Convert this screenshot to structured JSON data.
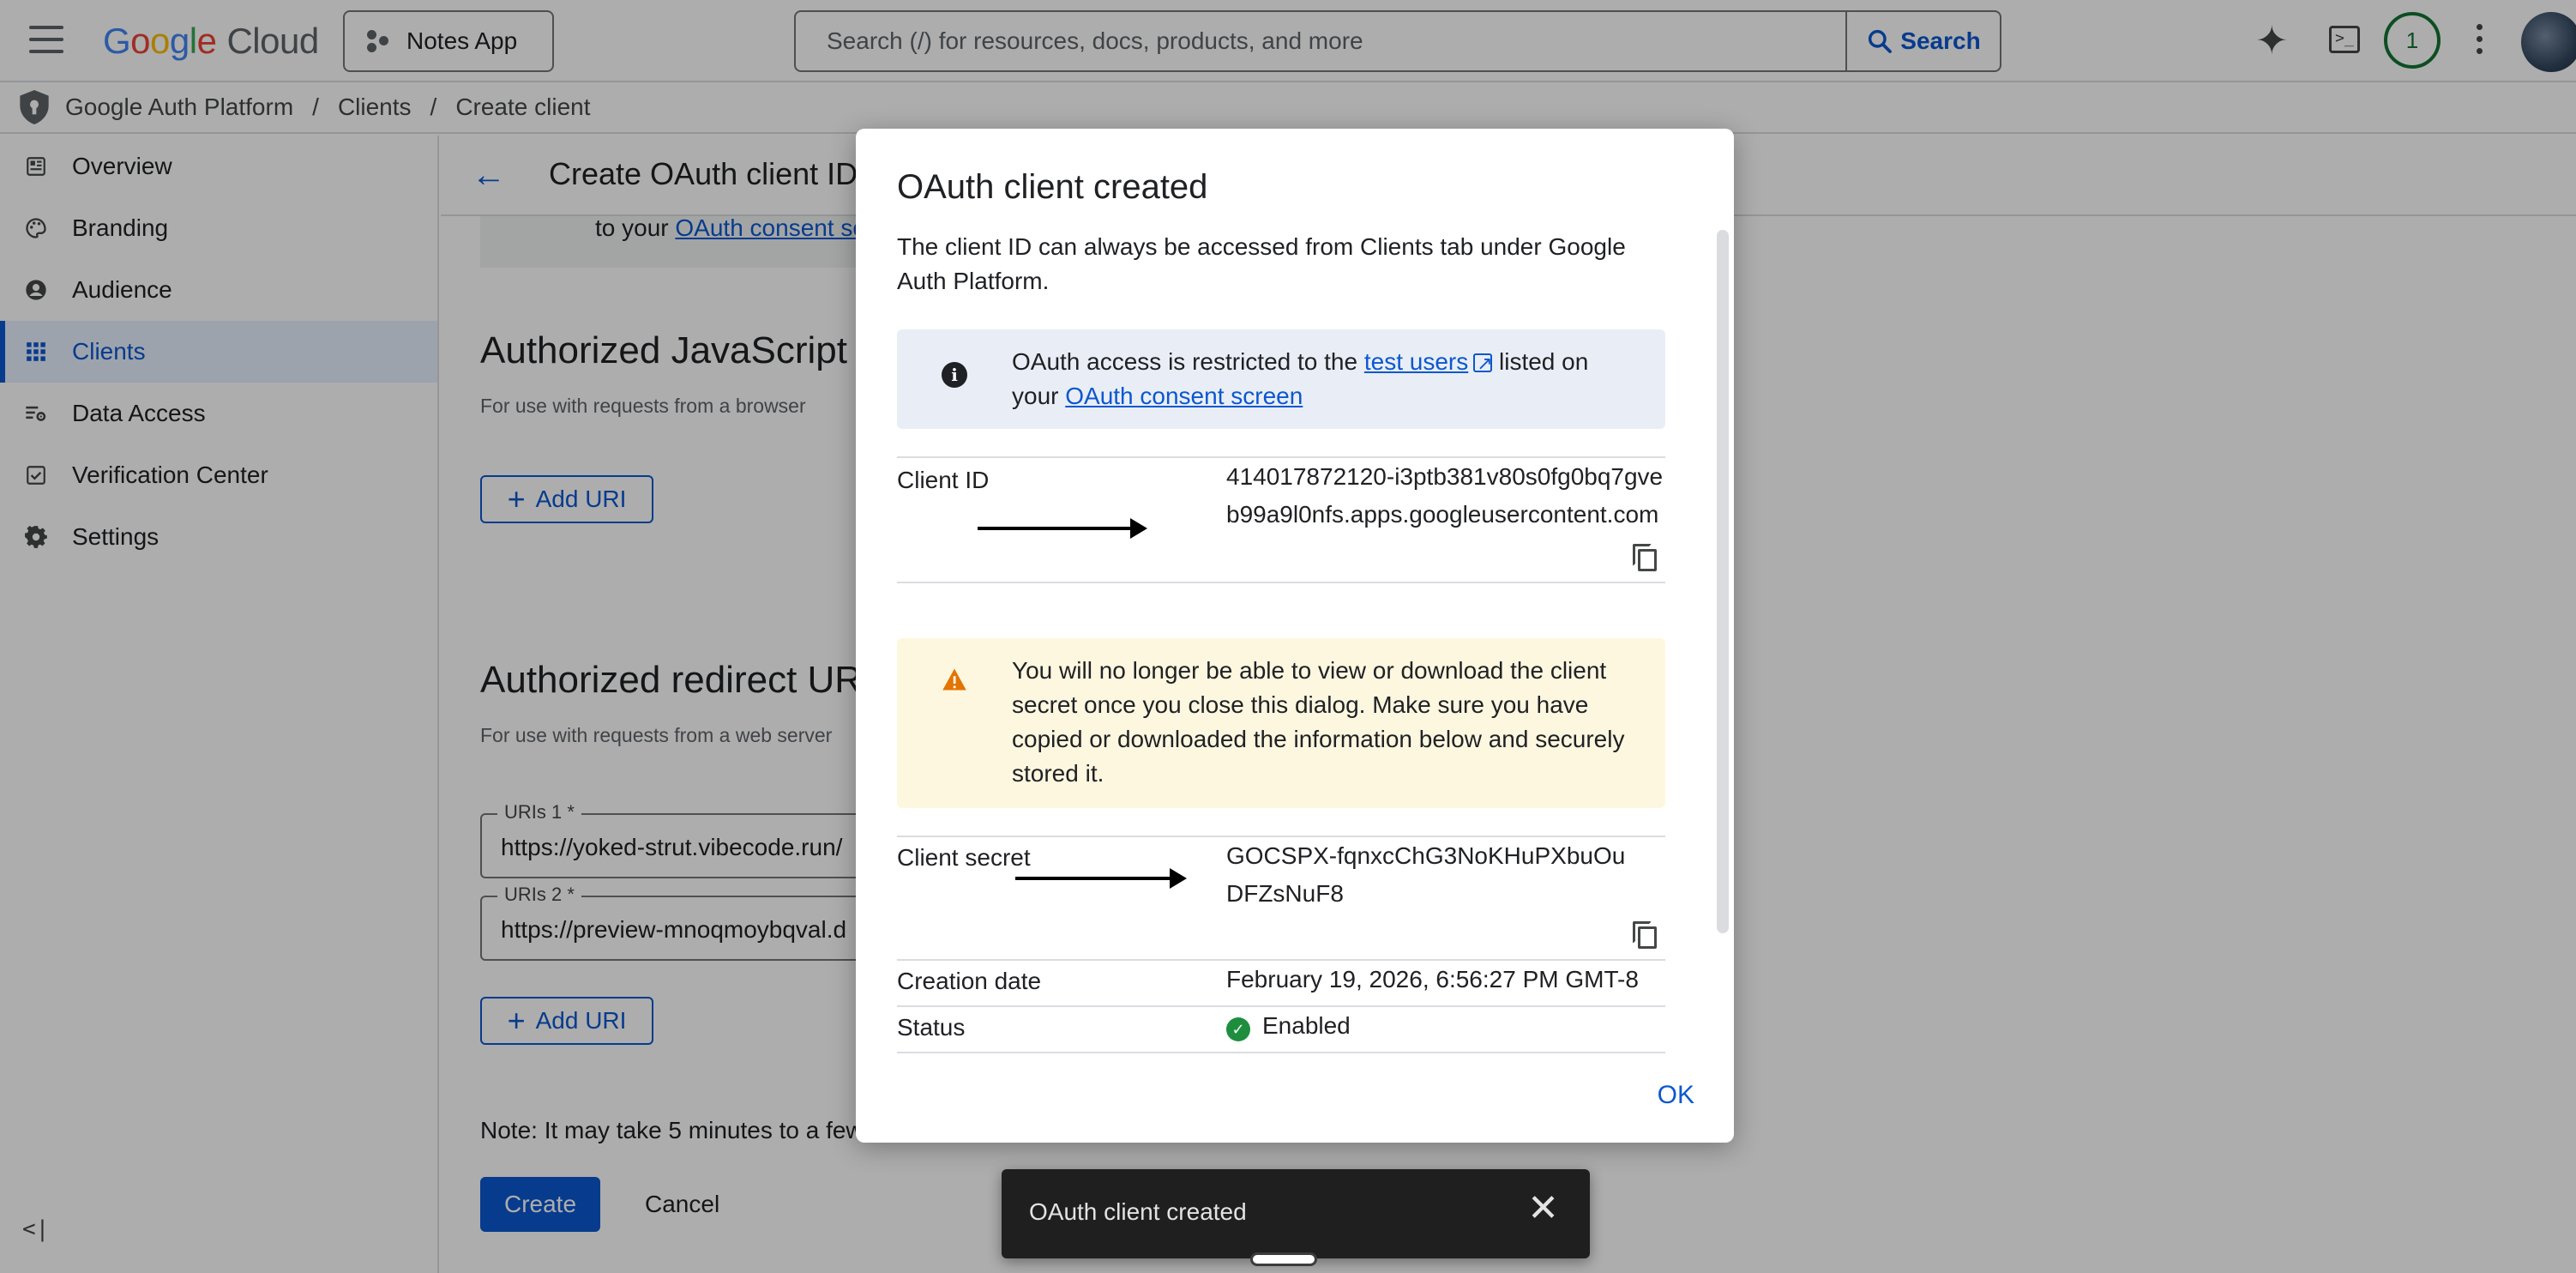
{
  "topbar": {
    "logo_google": [
      "G",
      "o",
      "o",
      "g",
      "l",
      "e"
    ],
    "logo_cloud": "Cloud",
    "project_label": "Notes App",
    "search_placeholder": "Search (/) for resources, docs, products, and more",
    "search_button": "Search",
    "notification_count": "1"
  },
  "breadcrumb": {
    "items": [
      "Google Auth Platform",
      "Clients",
      "Create client"
    ],
    "separator": "/"
  },
  "sidebar": {
    "items": [
      {
        "label": "Overview",
        "icon": "dashboard-icon"
      },
      {
        "label": "Branding",
        "icon": "palette-icon"
      },
      {
        "label": "Audience",
        "icon": "person-circle-icon"
      },
      {
        "label": "Clients",
        "icon": "apps-grid-icon",
        "active": true
      },
      {
        "label": "Data Access",
        "icon": "data-settings-icon"
      },
      {
        "label": "Verification Center",
        "icon": "check-box-icon"
      },
      {
        "label": "Settings",
        "icon": "gear-icon"
      }
    ],
    "collapse_glyph": "<|"
  },
  "main": {
    "page_title": "Create OAuth client ID",
    "consent_text_prefix": "to your",
    "consent_link": "OAuth consent sc",
    "js_origins_title": "Authorized JavaScript",
    "js_origins_sub": "For use with requests from a browser",
    "add_uri_label": "Add URI",
    "redirect_title": "Authorized redirect UR",
    "redirect_sub": "For use with requests from a web server",
    "uris": [
      {
        "label": "URIs 1 *",
        "value": "https://yoked-strut.vibecode.run/"
      },
      {
        "label": "URIs 2 *",
        "value": "https://preview-mnoqmoybqval.d"
      }
    ],
    "note": "Note: It may take 5 minutes to a few",
    "create_label": "Create",
    "cancel_label": "Cancel"
  },
  "dialog": {
    "title": "OAuth client created",
    "description": "The client ID can always be accessed from Clients tab under Google Auth Platform.",
    "info_prefix": "OAuth access is restricted to the",
    "info_link1": "test users",
    "info_middle": "listed on your",
    "info_link2": "OAuth consent screen",
    "client_id_label": "Client ID",
    "client_id_value": "414017872120-i3ptb381v80s0fg0bq7gveb99a9l0nfs.apps.googleusercontent.com",
    "warning": "You will no longer be able to view or download the client secret once you close this dialog. Make sure you have copied or downloaded the information below and securely stored it.",
    "client_secret_label": "Client secret",
    "client_secret_value": "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",
    "creation_date_label": "Creation date",
    "creation_date_value": "February 19, 2026, 6:56:27 PM GMT-8",
    "status_label": "Status",
    "status_value": "Enabled",
    "ok_label": "OK"
  },
  "snackbar": {
    "message": "OAuth client created",
    "close_glyph": "✕"
  },
  "colors": {
    "accent": "#0b57d0",
    "success": "#1e8e3e",
    "warning": "#e37400",
    "info_bg": "#e9eef6",
    "warn_bg": "#fef7e0"
  }
}
